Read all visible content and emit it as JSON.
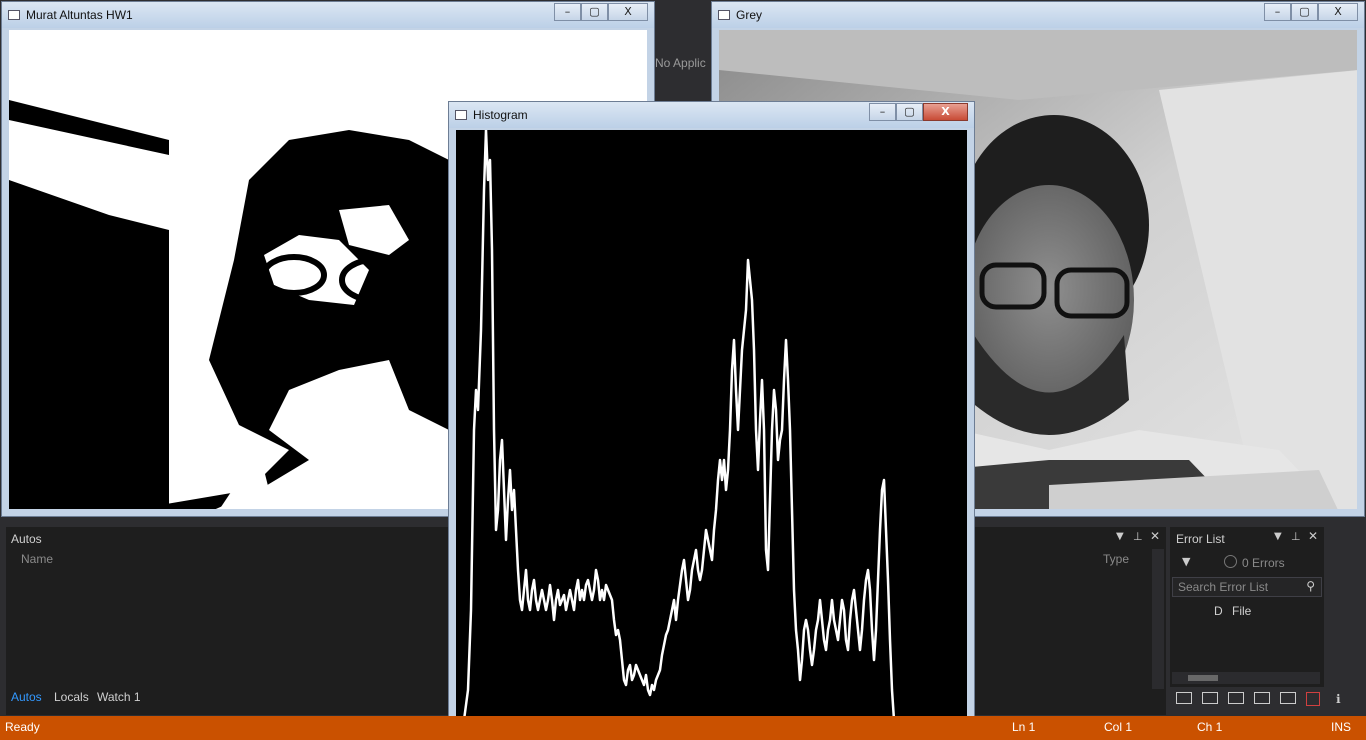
{
  "windows": {
    "binary": {
      "title": "Murat Altuntas HW1"
    },
    "grey": {
      "title": "Grey"
    },
    "histogram": {
      "title": "Histogram"
    }
  },
  "window_buttons": {
    "minimize": "–",
    "maximize": "▢",
    "close": "X"
  },
  "background": {
    "no_app_text": "No Applic"
  },
  "autos_panel": {
    "title": "Autos",
    "column_name": "Name",
    "column_type": "Type",
    "tabs": [
      "Autos",
      "Locals",
      "Watch 1"
    ]
  },
  "error_list": {
    "title": "Error List",
    "errors_label": "0 Errors",
    "search_placeholder": "Search Error List",
    "col_d": "D",
    "col_file": "File"
  },
  "status_bar": {
    "ready": "Ready",
    "ln": "Ln 1",
    "col": "Col 1",
    "ch": "Ch 1",
    "ins": "INS"
  },
  "colors": {
    "status_bar": "#ca5100",
    "accent_tab": "#3399ff",
    "panel_bg": "#1e1e1e"
  }
}
